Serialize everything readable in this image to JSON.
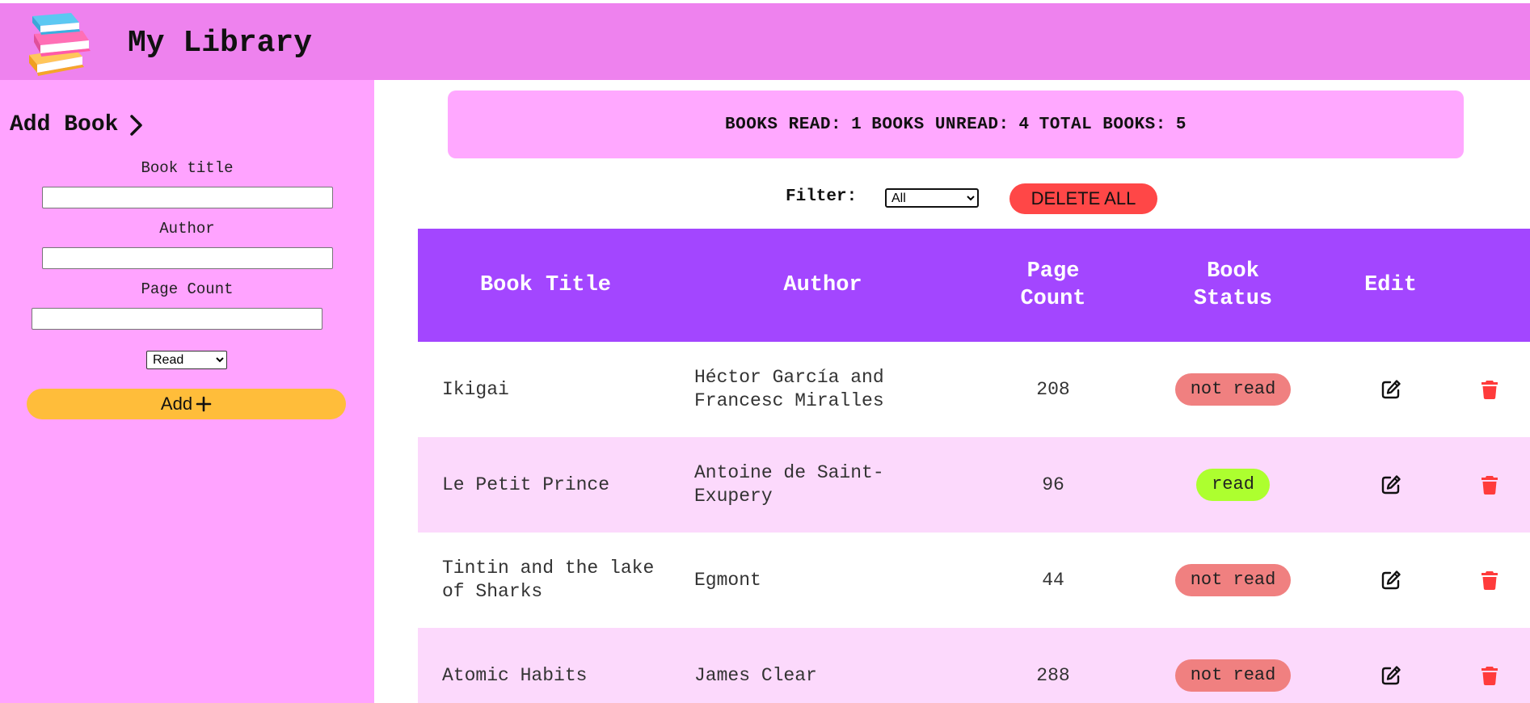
{
  "header": {
    "title": "My Library",
    "logo_icon": "books-stack-icon"
  },
  "sidebar": {
    "heading": "Add Book",
    "fields": {
      "title_label": "Book title",
      "title_value": "",
      "author_label": "Author",
      "author_value": "",
      "pages_label": "Page Count",
      "pages_value": ""
    },
    "status_select": {
      "selected": "Read"
    },
    "add_button_label": "Add"
  },
  "stats": {
    "read_label": "BOOKS READ:",
    "read_count": "1",
    "unread_label": "BOOKS UNREAD:",
    "unread_count": "4",
    "total_label": "TOTAL BOOKS:",
    "total_count": "5"
  },
  "filter": {
    "label": "Filter:",
    "selected": "All"
  },
  "delete_all_label": "DELETE ALL",
  "table": {
    "headers": {
      "title": "Book Title",
      "author": "Author",
      "pages": "Page Count",
      "status": "Book Status",
      "edit": "Edit"
    },
    "rows": [
      {
        "title": "Ikigai",
        "author": "Héctor García and Francesc Miralles",
        "pages": "208",
        "status": "not read"
      },
      {
        "title": "Le Petit Prince",
        "author": "Antoine de Saint-Exupery",
        "pages": "96",
        "status": "read"
      },
      {
        "title": "Tintin and the lake of Sharks",
        "author": "Egmont",
        "pages": "44",
        "status": "not read"
      },
      {
        "title": "Atomic Habits",
        "author": "James Clear",
        "pages": "288",
        "status": "not read"
      }
    ]
  },
  "colors": {
    "header_bg": "#ee82ee",
    "sidebar_bg": "#ffa3ff",
    "stats_bg": "#ffa8ff",
    "table_header_bg": "#a346ff",
    "row_alt_bg": "#fcd9fc",
    "not_read_badge": "#f08080",
    "read_badge": "#adff2f",
    "add_button": "#ffbd3a",
    "delete": "#ff4747"
  }
}
